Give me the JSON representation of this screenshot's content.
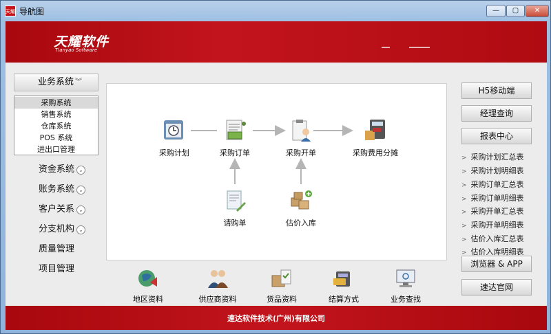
{
  "window": {
    "title": "导航图",
    "app_icon_text": "天耀"
  },
  "header": {
    "logo_cn": "天耀软件",
    "logo_en": "Tianyao Software"
  },
  "left_menu": {
    "head": "业务系统",
    "submenu": [
      "采购系统",
      "销售系统",
      "仓库系统",
      "POS 系统",
      "进出口管理"
    ],
    "selected": "采购系统",
    "groups": [
      "资金系统",
      "账务系统",
      "客户关系",
      "分支机构",
      "质量管理",
      "项目管理"
    ]
  },
  "flow": {
    "top": [
      "采购计划",
      "采购订单",
      "采购开单",
      "采购费用分摊"
    ],
    "bottom": [
      "请购单",
      "估价入库"
    ]
  },
  "bottom_nav": [
    "地区资料",
    "供应商资料",
    "货品资料",
    "结算方式",
    "业务查找"
  ],
  "right": {
    "buttons": [
      "H5移动端",
      "经理查询",
      "报表中心"
    ],
    "reports": [
      "采购计划汇总表",
      "采购计划明细表",
      "采购订单汇总表",
      "采购订单明细表",
      "采购开单汇总表",
      "采购开单明细表",
      "估价入库汇总表",
      "估价入库明细表"
    ],
    "browser_btn": "浏览器 & APP",
    "site_btn": "速达官网"
  },
  "footer": {
    "text": "速达软件技术(广州)有限公司"
  },
  "colors": {
    "brand_red": "#b50d14",
    "panel_bg": "#ffffff"
  }
}
